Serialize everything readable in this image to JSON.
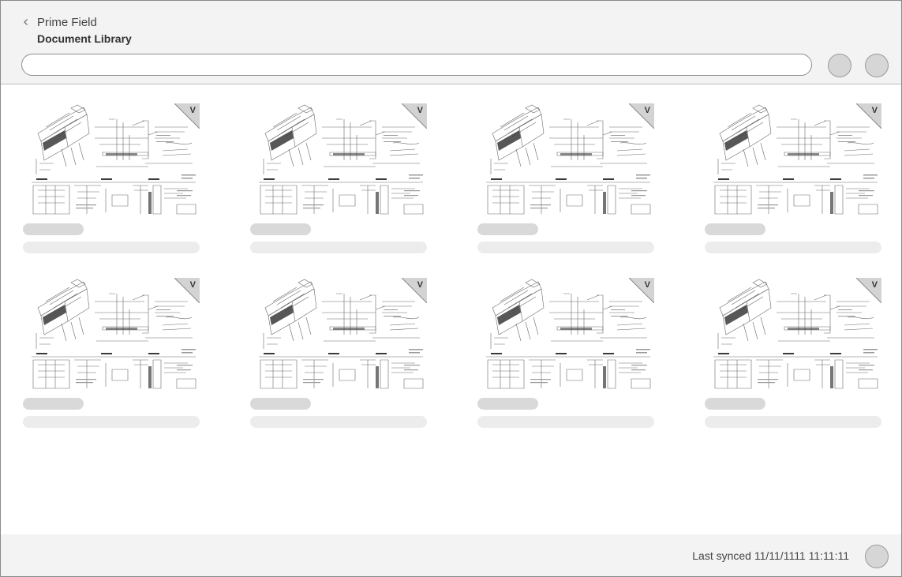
{
  "header": {
    "back_label": "Prime Field",
    "title": "Document Library",
    "search": {
      "value": "",
      "placeholder": ""
    },
    "action_buttons": [
      "circle-button",
      "circle-button"
    ]
  },
  "documents": [
    {
      "badge": "V",
      "thumbnail": "architectural-detail-drawing"
    },
    {
      "badge": "V",
      "thumbnail": "architectural-detail-drawing"
    },
    {
      "badge": "V",
      "thumbnail": "architectural-detail-drawing"
    },
    {
      "badge": "V",
      "thumbnail": "architectural-detail-drawing"
    },
    {
      "badge": "V",
      "thumbnail": "architectural-detail-drawing"
    },
    {
      "badge": "V",
      "thumbnail": "architectural-detail-drawing"
    },
    {
      "badge": "V",
      "thumbnail": "architectural-detail-drawing"
    },
    {
      "badge": "V",
      "thumbnail": "architectural-detail-drawing"
    }
  ],
  "footer": {
    "sync_status": "Last synced 11/11/1111 11:11:11"
  },
  "colors": {
    "header_bg": "#f3f3f3",
    "skeleton_dark": "#d9d9d9",
    "skeleton_light": "#ececec",
    "badge_bg": "#d3d3d3"
  }
}
